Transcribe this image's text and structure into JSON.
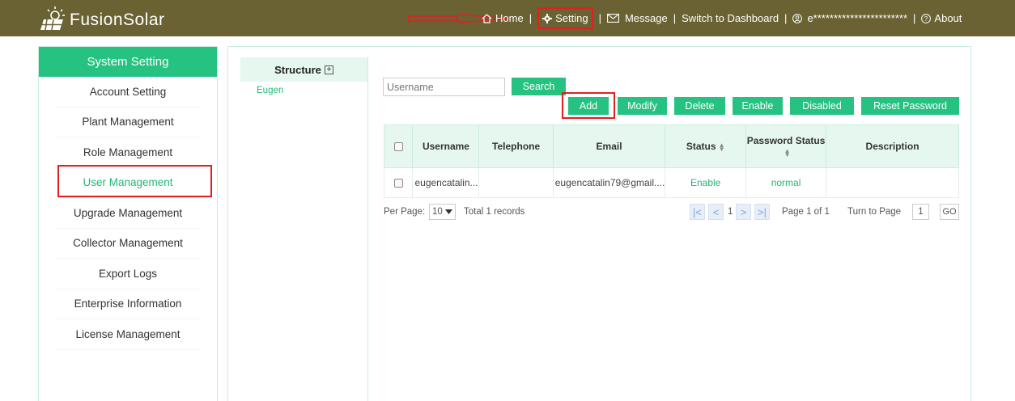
{
  "app": {
    "name": "FusionSolar"
  },
  "nav": {
    "home": "Home",
    "setting": "Setting",
    "message": "Message",
    "switch_dashboard": "Switch to Dashboard",
    "user": "e***********************",
    "about": "About",
    "separator": "|"
  },
  "sidebar": {
    "title": "System Setting",
    "items": [
      {
        "label": "Account Setting"
      },
      {
        "label": "Plant Management"
      },
      {
        "label": "Role Management"
      },
      {
        "label": "User Management",
        "active": true
      },
      {
        "label": "Upgrade Management"
      },
      {
        "label": "Collector Management"
      },
      {
        "label": "Export Logs"
      },
      {
        "label": "Enterprise Information"
      },
      {
        "label": "License Management"
      }
    ]
  },
  "tree": {
    "title": "Structure",
    "nodes": [
      "Eugen"
    ]
  },
  "toolbar": {
    "search_placeholder": "Username",
    "search": "Search",
    "add": "Add",
    "modify": "Modify",
    "delete": "Delete",
    "enable": "Enable",
    "disabled": "Disabled",
    "reset_password": "Reset Password"
  },
  "table": {
    "columns": [
      "Username",
      "Telephone",
      "Email",
      "Status",
      "Password Status",
      "Description"
    ],
    "rows": [
      {
        "username": "eugencatalin...",
        "telephone": "",
        "email": "eugencatalin79@gmail....",
        "status": "Enable",
        "password_status": "normal",
        "description": ""
      }
    ]
  },
  "pagination": {
    "per_page_label": "Per Page:",
    "per_page": "10",
    "total": "Total 1 records",
    "current": "1",
    "page_word": "Page",
    "page_num": "1",
    "of_word": "of",
    "page_total": "1",
    "turn_to": "Turn to Page",
    "goto_value": "1",
    "go": "GO"
  },
  "colors": {
    "topbar": "#6b6233",
    "accent": "#26c281",
    "highlight": "#e02020"
  },
  "icons": [
    "logo-icon",
    "home-icon",
    "gear-icon",
    "mail-icon",
    "user-icon",
    "help-icon",
    "plus-box-icon",
    "chevron-down-icon",
    "first-page-icon",
    "prev-page-icon",
    "next-page-icon",
    "last-page-icon"
  ]
}
